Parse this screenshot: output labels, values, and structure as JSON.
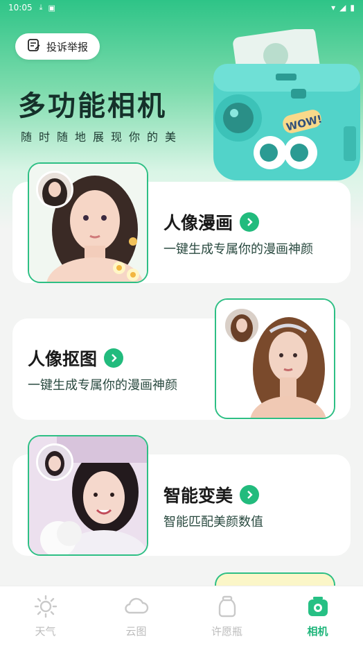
{
  "status_bar": {
    "time": "10:05"
  },
  "header": {
    "report_label": "投诉举报",
    "title": "多功能相机",
    "subtitle": "随时随地展现你的美",
    "camera_sticker": "WOW!"
  },
  "cards": [
    {
      "title": "人像漫画",
      "desc": "一键生成专属你的漫画神颜"
    },
    {
      "title": "人像抠图",
      "desc": "一键生成专属你的漫画神颜"
    },
    {
      "title": "智能变美",
      "desc": "智能匹配美颜数值"
    }
  ],
  "tabs": [
    {
      "label": "天气",
      "icon": "sun-icon"
    },
    {
      "label": "云图",
      "icon": "cloud-icon"
    },
    {
      "label": "许愿瓶",
      "icon": "jar-icon"
    },
    {
      "label": "相机",
      "icon": "camera-icon",
      "active": true
    }
  ],
  "colors": {
    "accent": "#22bb7d",
    "title": "#15302a"
  }
}
